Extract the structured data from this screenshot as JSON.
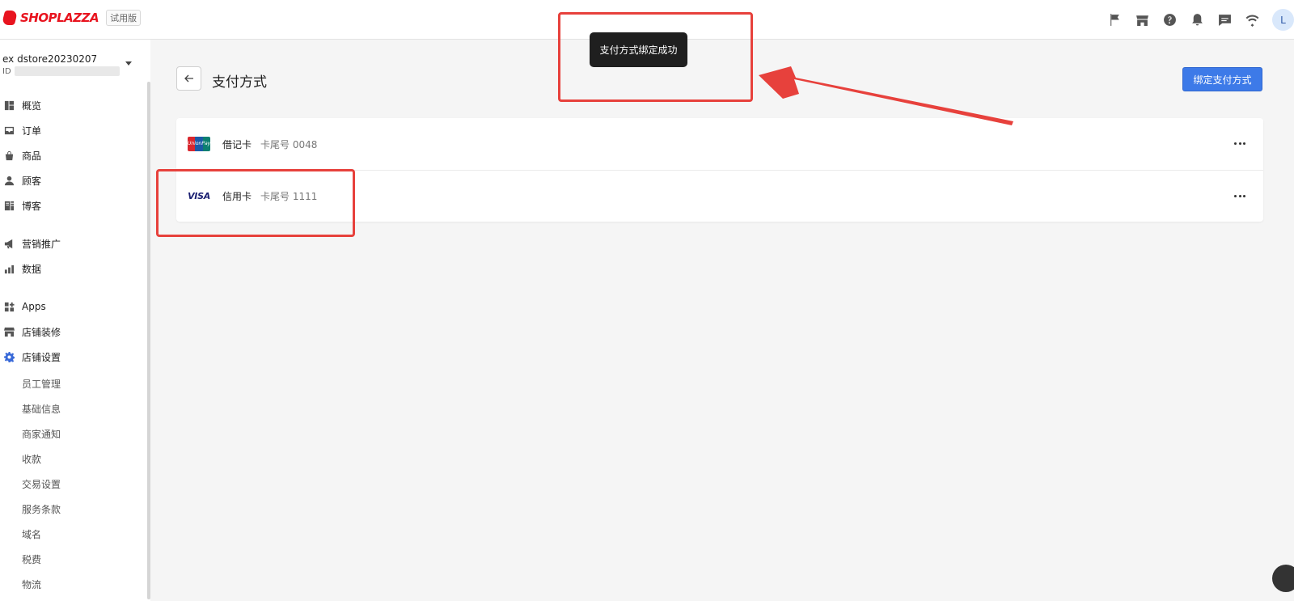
{
  "app": {
    "brand": "SHOPLAZZA",
    "trial_badge": "试用版",
    "avatar_letter": "L"
  },
  "topbar_icons": [
    "flag-icon",
    "store-icon",
    "help-icon",
    "bell-icon",
    "message-icon",
    "wifi-icon"
  ],
  "sidebar": {
    "store_name": "ex    dstore20230207",
    "store_id_label": "ID",
    "items": [
      {
        "label": "概览",
        "icon": "dashboard-icon"
      },
      {
        "label": "订单",
        "icon": "inbox-icon"
      },
      {
        "label": "商品",
        "icon": "bag-icon"
      },
      {
        "label": "顾客",
        "icon": "person-icon"
      },
      {
        "label": "博客",
        "icon": "blog-icon"
      },
      {
        "label": "营销推广",
        "icon": "megaphone-icon"
      },
      {
        "label": "数据",
        "icon": "bar-chart-icon"
      },
      {
        "label": "Apps",
        "icon": "apps-icon"
      },
      {
        "label": "店铺装修",
        "icon": "storefront-icon"
      },
      {
        "label": "店铺设置",
        "icon": "gear-icon",
        "active": true
      }
    ],
    "sub_items": [
      "员工管理",
      "基础信息",
      "商家通知",
      "收款",
      "交易设置",
      "服务条款",
      "域名",
      "税费",
      "物流"
    ]
  },
  "page": {
    "title": "支付方式",
    "bind_button": "绑定支付方式"
  },
  "payment_methods": [
    {
      "brand": "UnionPay",
      "brand_text": "UnionPay",
      "type": "借记卡",
      "number": "卡尾号 0048"
    },
    {
      "brand": "VISA",
      "brand_text": "VISA",
      "type": "信用卡",
      "number": "卡尾号 1111"
    }
  ],
  "toast": {
    "message": "支付方式绑定成功"
  },
  "colors": {
    "accent": "#3d7ae8",
    "brand_red": "#e8141f",
    "annotation": "#e7413c"
  }
}
